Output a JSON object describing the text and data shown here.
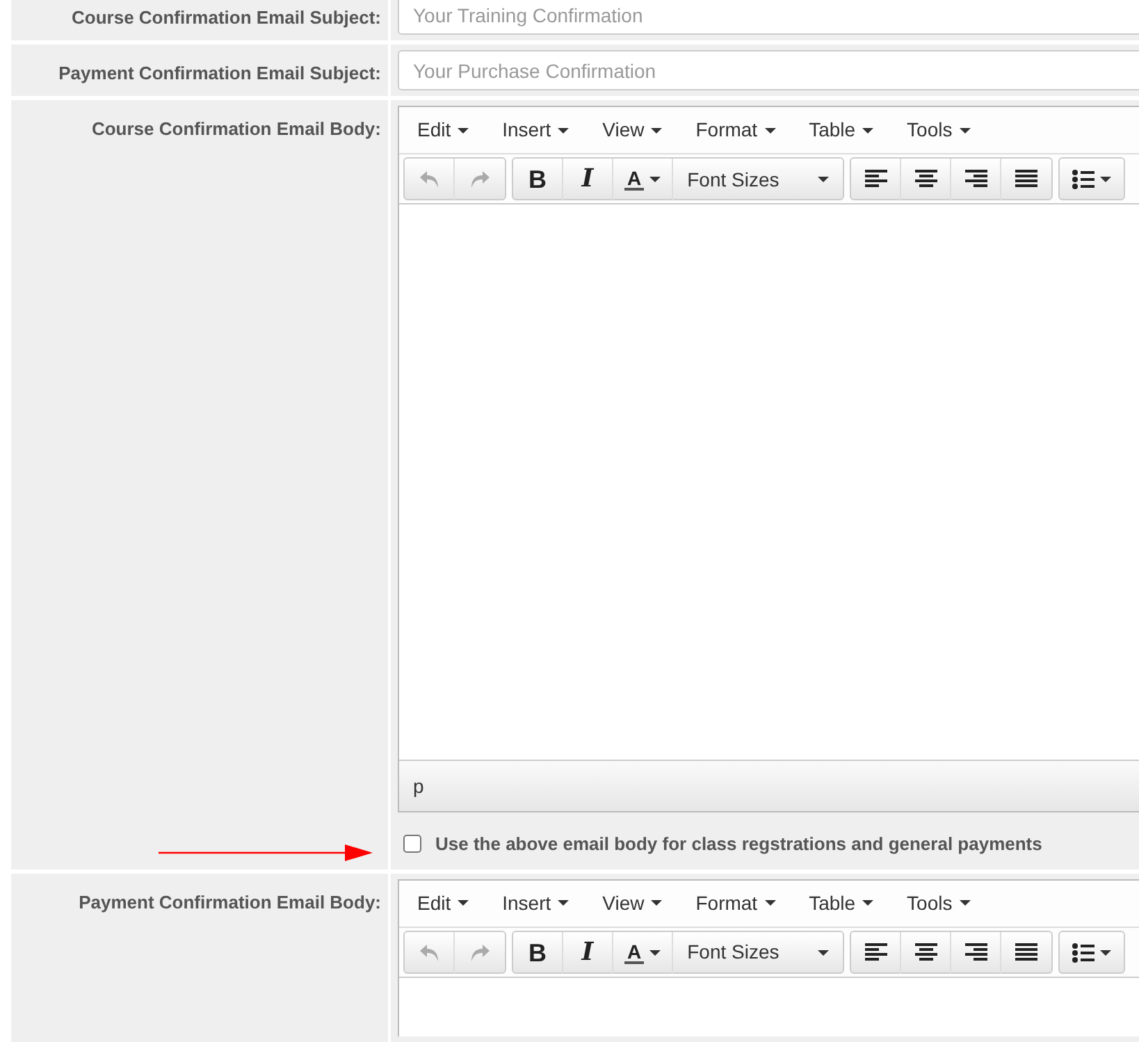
{
  "rows": [
    {
      "kind": "text",
      "label": "Course Confirmation Email Subject:",
      "placeholder": "Your Training Confirmation"
    },
    {
      "kind": "text",
      "label": "Payment Confirmation Email Subject:",
      "placeholder": "Your Purchase Confirmation"
    },
    {
      "kind": "editor",
      "label": "Course Confirmation Email Body:",
      "menu": [
        "Edit",
        "Insert",
        "View",
        "Format",
        "Table",
        "Tools"
      ],
      "toolbar": [
        [
          {
            "kind": "undo",
            "disabled": true
          },
          {
            "kind": "redo",
            "disabled": true
          }
        ],
        [
          {
            "kind": "bold",
            "label": "B",
            "disabled": false
          },
          {
            "kind": "italic",
            "label": "I",
            "disabled": false
          },
          {
            "kind": "forecolor",
            "label": "A",
            "disabled": false
          },
          {
            "kind": "fontsize",
            "label": "Font Sizes",
            "disabled": false
          }
        ],
        [
          {
            "kind": "alignleft",
            "disabled": false
          },
          {
            "kind": "aligncenter",
            "disabled": false
          },
          {
            "kind": "alignright",
            "disabled": false
          },
          {
            "kind": "alignjustify",
            "disabled": false
          }
        ],
        [
          {
            "kind": "bullist",
            "disabled": false
          }
        ]
      ],
      "status_path": "p",
      "checkbox": {
        "label": "Use the above email body for class regstrations and general payments",
        "checked": false
      }
    },
    {
      "kind": "editor",
      "label": "Payment Confirmation Email Body:",
      "menu": [
        "Edit",
        "Insert",
        "View",
        "Format",
        "Table",
        "Tools"
      ],
      "toolbar": [
        [
          {
            "kind": "undo",
            "disabled": true
          },
          {
            "kind": "redo",
            "disabled": true
          }
        ],
        [
          {
            "kind": "bold",
            "label": "B",
            "disabled": false
          },
          {
            "kind": "italic",
            "label": "I",
            "disabled": false
          },
          {
            "kind": "forecolor",
            "label": "A",
            "disabled": false
          },
          {
            "kind": "fontsize",
            "label": "Font Sizes",
            "disabled": false
          }
        ],
        [
          {
            "kind": "alignleft",
            "disabled": false
          },
          {
            "kind": "aligncenter",
            "disabled": false
          },
          {
            "kind": "alignright",
            "disabled": false
          },
          {
            "kind": "alignjustify",
            "disabled": false
          }
        ],
        [
          {
            "kind": "bullist",
            "disabled": false
          }
        ]
      ]
    }
  ]
}
